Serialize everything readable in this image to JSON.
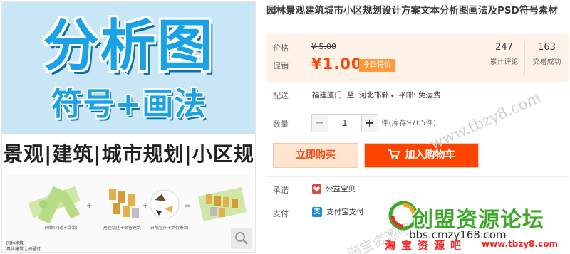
{
  "product_image": {
    "hero_title": "分析图",
    "hero_subtitle": "符号+画法",
    "categories": "景观|建筑|城市规划|小区规划",
    "thumb_captions": [
      "网络(河道+绿带)",
      "居住组团+保留建筑",
      "开敞空间+步行景观"
    ],
    "corner_text": [
      "园林建筑",
      "具体建筑之间通过…"
    ],
    "zoom_icon": "magnifier-icon"
  },
  "title": "园林景观建筑城市小区规划设计方案文本分析图画法及PSD符号素材",
  "price": {
    "original_label": "价格",
    "original_value": "¥ 5.00",
    "promo_label": "促销",
    "promo_value": "¥1.00",
    "promo_tag": "今日特价",
    "stats": [
      {
        "value": "247",
        "label": "累计评论"
      },
      {
        "value": "163",
        "label": "交易成功"
      }
    ]
  },
  "delivery": {
    "label": "配送",
    "from": "福建厦门",
    "to_word": "至",
    "destination": "河北邯郸",
    "shipping": "平邮: 免运费"
  },
  "quantity": {
    "label": "数量",
    "minus": "−",
    "value": "1",
    "plus": "+",
    "stock": "件(库存9765件)"
  },
  "buttons": {
    "buy_now": "立即购买",
    "add_to_cart": "加入购物车"
  },
  "promise": {
    "label": "承诺",
    "value": "公益宝贝"
  },
  "payment": {
    "label": "支付",
    "alipay": "支付宝支付",
    "alipay_icon_text": "支"
  },
  "watermark": {
    "url": "www.tbzy8.com",
    "vertical": "淘宝资源吧",
    "logo": "创盟资源论坛",
    "logo_url": "bbs.cmzy168.com",
    "red_text": "淘宝资源吧",
    "red_url": "www.tbzy8.com"
  },
  "colors": {
    "accent": "#ff4400",
    "hero_blue": "#1aa2e6",
    "price_bg": "#fff2e8",
    "promo_tag_bg": "#ff9a3c",
    "logo_green": "#3daa2c"
  }
}
